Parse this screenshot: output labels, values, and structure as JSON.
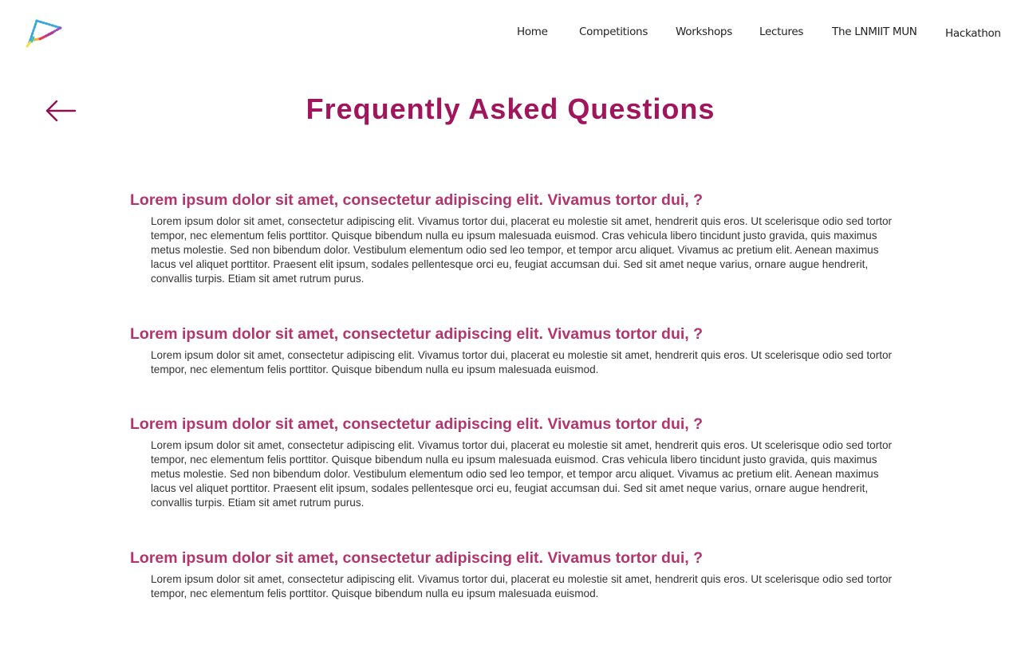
{
  "nav": {
    "items": [
      {
        "label": "Home"
      },
      {
        "label": "Competitions"
      },
      {
        "label": "Workshops"
      },
      {
        "label": "Lectures"
      },
      {
        "label": "The LNMIIT MUN"
      },
      {
        "label": "Hackathon"
      }
    ]
  },
  "page": {
    "title": "Frequently Asked Questions"
  },
  "faq": [
    {
      "question": "Lorem ipsum dolor sit amet, consectetur adipiscing elit. Vivamus tortor dui, ?",
      "answer": "Lorem ipsum dolor sit amet, consectetur adipiscing elit. Vivamus tortor dui, placerat eu molestie sit amet, hendrerit quis eros. Ut scelerisque odio sed tortor tempor, nec elementum felis porttitor. Quisque bibendum nulla eu ipsum malesuada euismod. Cras vehicula libero tincidunt justo gravida, quis maximus metus molestie. Sed non bibendum dolor. Vestibulum elementum odio sed leo tempor, et tempor arcu aliquet. Vivamus ac pretium elit. Aenean maximus lacus vel aliquet porttitor. Praesent elit ipsum, sodales pellentesque orci eu, feugiat accumsan dui. Sed sit amet neque varius, ornare augue hendrerit, convallis turpis. Etiam sit amet rutrum purus."
    },
    {
      "question": "Lorem ipsum dolor sit amet, consectetur adipiscing elit. Vivamus tortor dui, ?",
      "answer": "Lorem ipsum dolor sit amet, consectetur adipiscing elit. Vivamus tortor dui, placerat eu molestie sit amet, hendrerit quis eros. Ut scelerisque odio sed tortor tempor, nec elementum felis porttitor. Quisque bibendum nulla eu ipsum malesuada euismod."
    },
    {
      "question": "Lorem ipsum dolor sit amet, consectetur adipiscing elit. Vivamus tortor dui, ?",
      "answer": "Lorem ipsum dolor sit amet, consectetur adipiscing elit. Vivamus tortor dui, placerat eu molestie sit amet, hendrerit quis eros. Ut scelerisque odio sed tortor tempor, nec elementum felis porttitor. Quisque bibendum nulla eu ipsum malesuada euismod. Cras vehicula libero tincidunt justo gravida, quis maximus metus molestie. Sed non bibendum dolor. Vestibulum elementum odio sed leo tempor, et tempor arcu aliquet. Vivamus ac pretium elit. Aenean maximus lacus vel aliquet porttitor. Praesent elit ipsum, sodales pellentesque orci eu, feugiat accumsan dui. Sed sit amet neque varius, ornare augue hendrerit, convallis turpis. Etiam sit amet rutrum purus."
    },
    {
      "question": "Lorem ipsum dolor sit amet, consectetur adipiscing elit. Vivamus tortor dui, ?",
      "answer": "Lorem ipsum dolor sit amet, consectetur adipiscing elit. Vivamus tortor dui, placerat eu molestie sit amet, hendrerit quis eros. Ut scelerisque odio sed tortor tempor, nec elementum felis porttitor. Quisque bibendum nulla eu ipsum malesuada euismod."
    }
  ],
  "icons": {
    "logo": "triangle-logo-icon",
    "back": "arrow-left-icon"
  },
  "colors": {
    "title": "#a0155b",
    "question": "#b2356d",
    "body_text": "#333333",
    "back_arrow": "#8e1152"
  }
}
